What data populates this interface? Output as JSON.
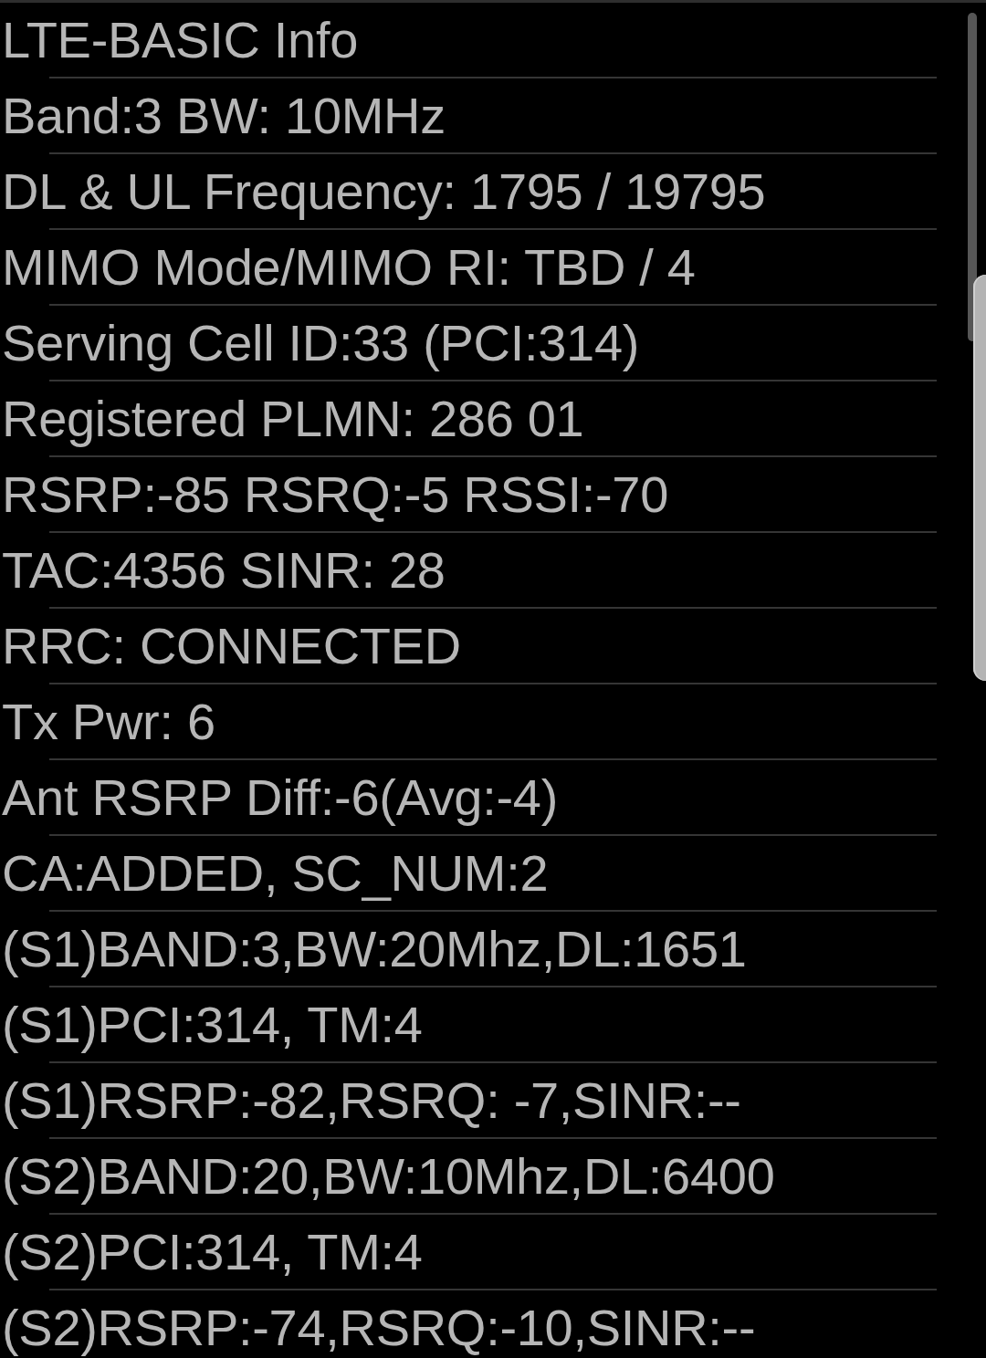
{
  "title": "LTE-BASIC Info",
  "rows": [
    "Band:3 BW: 10MHz",
    "DL & UL Frequency: 1795 / 19795",
    "MIMO Mode/MIMO RI: TBD / 4",
    "Serving Cell ID:33 (PCI:314)",
    "Registered PLMN: 286 01",
    "RSRP:-85 RSRQ:-5 RSSI:-70",
    "TAC:4356 SINR: 28",
    "RRC: CONNECTED",
    "Tx Pwr: 6",
    "Ant RSRP Diff:-6(Avg:-4)",
    "CA:ADDED, SC_NUM:2",
    "(S1)BAND:3,BW:20Mhz,DL:1651",
    "(S1)PCI:314, TM:4",
    "(S1)RSRP:-82,RSRQ: -7,SINR:--",
    "(S2)BAND:20,BW:10Mhz,DL:6400",
    "(S2)PCI:314, TM:4",
    "(S2)RSRP:-74,RSRQ:-10,SINR:--"
  ]
}
